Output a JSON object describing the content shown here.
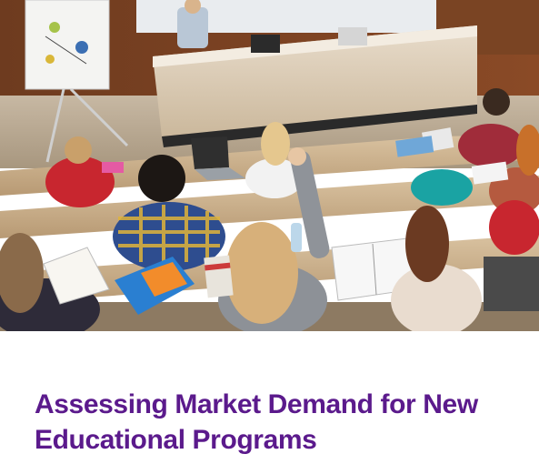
{
  "article": {
    "title": "Assessing Market Demand for New Educational Programs",
    "image_icon": "lecture-hall-photo",
    "colors": {
      "title": "#5b1a8c",
      "background": "#ffffff"
    }
  }
}
